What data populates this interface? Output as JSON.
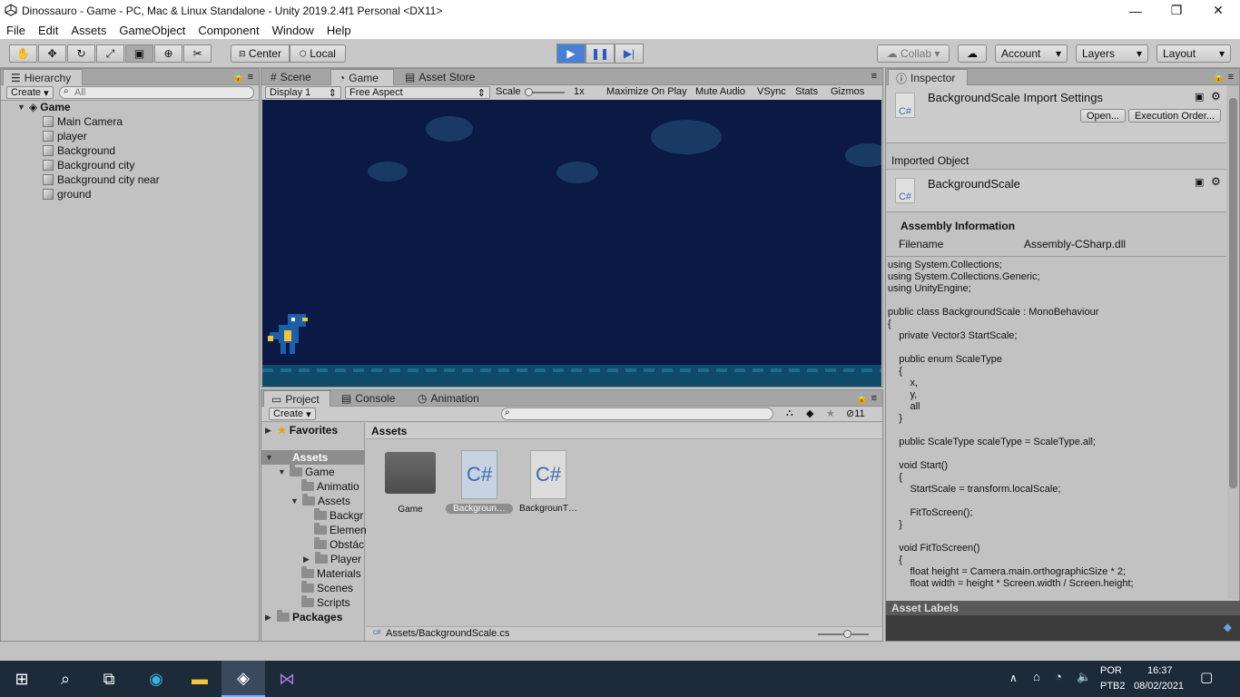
{
  "window": {
    "title": "Dinossauro - Game - PC, Mac & Linux Standalone - Unity 2019.2.4f1 Personal <DX11>",
    "minimize": "—",
    "restore": "❐",
    "close": "✕"
  },
  "menu": [
    "File",
    "Edit",
    "Assets",
    "GameObject",
    "Component",
    "Window",
    "Help"
  ],
  "toolbar": {
    "pivot": "Center",
    "space": "Local",
    "collab": "Collab",
    "account": "Account",
    "layers": "Layers",
    "layout": "Layout"
  },
  "hierarchy": {
    "tab": "Hierarchy",
    "create": "Create",
    "search_placeholder": "All",
    "scene": "Game",
    "items": [
      "Main Camera",
      "player",
      "Background",
      "Background city",
      "Background city near",
      "ground"
    ]
  },
  "center_tabs": {
    "scene": "Scene",
    "game": "Game",
    "asset_store": "Asset Store"
  },
  "game_bar": {
    "display": "Display 1",
    "aspect": "Free Aspect",
    "scale_label": "Scale",
    "scale_value": "1x",
    "maximize": "Maximize On Play",
    "mute": "Mute Audio",
    "vsync": "VSync",
    "stats": "Stats",
    "gizmos": "Gizmos"
  },
  "project": {
    "tabs": [
      "Project",
      "Console",
      "Animation"
    ],
    "create": "Create",
    "count": "11",
    "favorites": "Favorites",
    "assets_header": "Assets",
    "tree": {
      "assets": "Assets",
      "game": "Game",
      "animation": "Animatio",
      "assets_sub": "Assets",
      "background": "Backgr",
      "elements": "Elemen",
      "obstacles": "Obstác",
      "player": "Player",
      "materials": "Materials",
      "scenes": "Scenes",
      "scripts": "Scripts",
      "packages": "Packages"
    },
    "files": [
      {
        "name": "Game",
        "type": "folder"
      },
      {
        "name": "Backgroun…",
        "type": "cs"
      },
      {
        "name": "BackgrounT…",
        "type": "cs"
      }
    ],
    "cs_label": "C#",
    "path": "Assets/BackgroundScale.cs"
  },
  "inspector": {
    "tab": "Inspector",
    "title": "BackgroundScale Import Settings",
    "open": "Open...",
    "exec_order": "Execution Order...",
    "imported_object": "Imported Object",
    "object_name": "BackgroundScale",
    "assembly_info": "Assembly Information",
    "filename_label": "Filename",
    "filename_value": "Assembly-CSharp.dll",
    "code": "using System.Collections;\nusing System.Collections.Generic;\nusing UnityEngine;\n\npublic class BackgroundScale : MonoBehaviour\n{\n    private Vector3 StartScale;\n\n    public enum ScaleType\n    {\n        x,\n        y,\n        all\n    }\n\n    public ScaleType scaleType = ScaleType.all;\n\n    void Start()\n    {\n        StartScale = transform.localScale;\n\n        FitToScreen();\n    }\n\n    void FitToScreen()\n    {\n        float height = Camera.main.orthographicSize * 2;\n        float width = height * Screen.width / Screen.height;",
    "asset_labels": "Asset Labels"
  },
  "taskbar": {
    "lang": "POR",
    "layout": "PTB2",
    "time": "16:37",
    "date": "08/02/2021"
  }
}
